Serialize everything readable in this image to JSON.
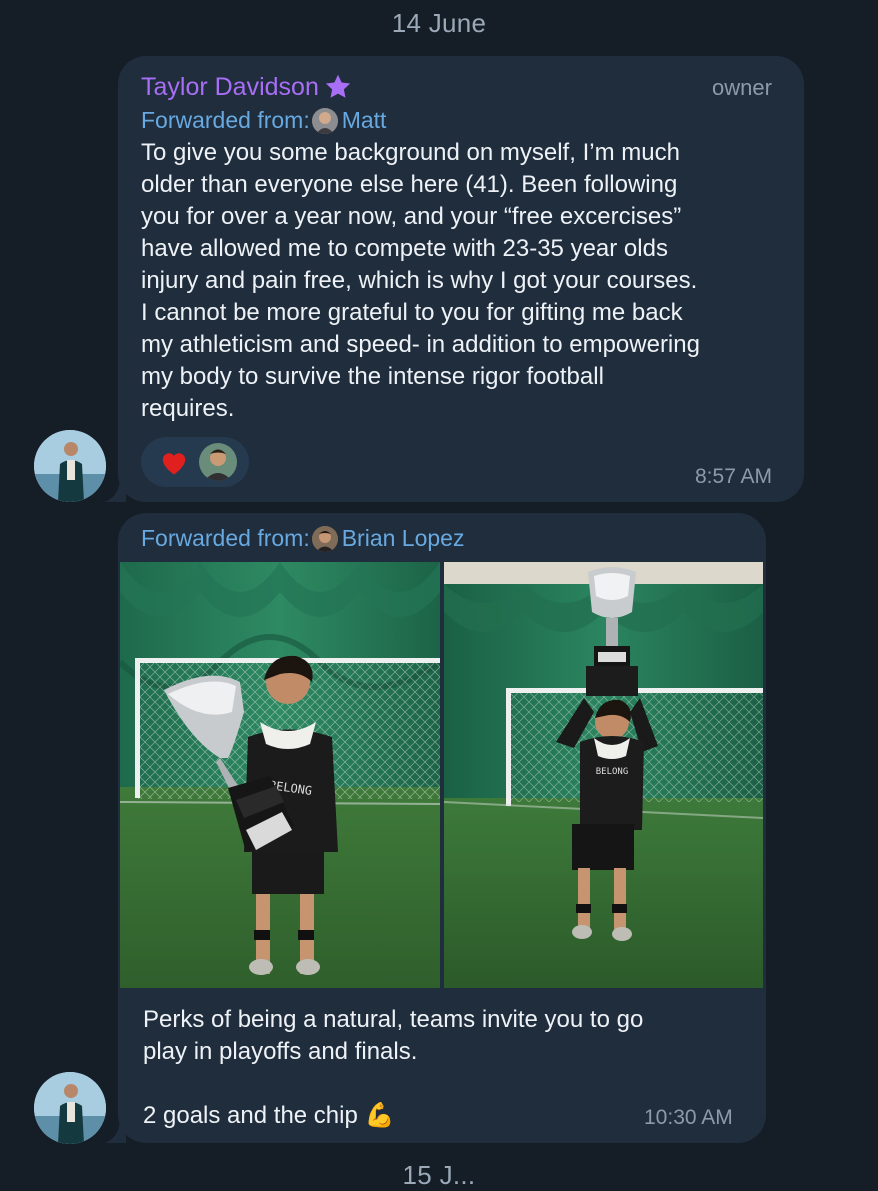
{
  "date_headers": {
    "top": "14 June",
    "bottom": "15 J..."
  },
  "message1": {
    "sender": "Taylor Davidson",
    "sender_badge_icon": "star-icon",
    "role": "owner",
    "forwarded_prefix": "Forwarded from:",
    "forwarded_name": "Matt",
    "text": "To give you some background on myself, I’m much\nolder than everyone else here (41). Been following\nyou for over a year now, and your “free excercises”\nhave allowed me to compete with 23-35 year olds\ninjury and pain free, which is why I got your courses.\nI cannot be more grateful to you for gifting me back\nmy athleticism and speed- in addition to empowering\nmy body to survive the intense rigor football\nrequires.",
    "reaction_emoji": "❤",
    "time": "8:57 AM"
  },
  "message2": {
    "forwarded_prefix": "Forwarded from:",
    "forwarded_name": "Brian Lopez",
    "photo_shirt_text": "I BELONG TO JESUS",
    "text": "Perks of being a natural, teams invite you to go\nplay in playoffs and finals.\n\n2 goals and the chip 💪",
    "time": "10:30 AM"
  },
  "colors": {
    "background": "#151d27",
    "bubble": "#1f2d3d",
    "sender": "#a86ef5",
    "link": "#67a9e0",
    "muted": "#8c9aa9"
  }
}
